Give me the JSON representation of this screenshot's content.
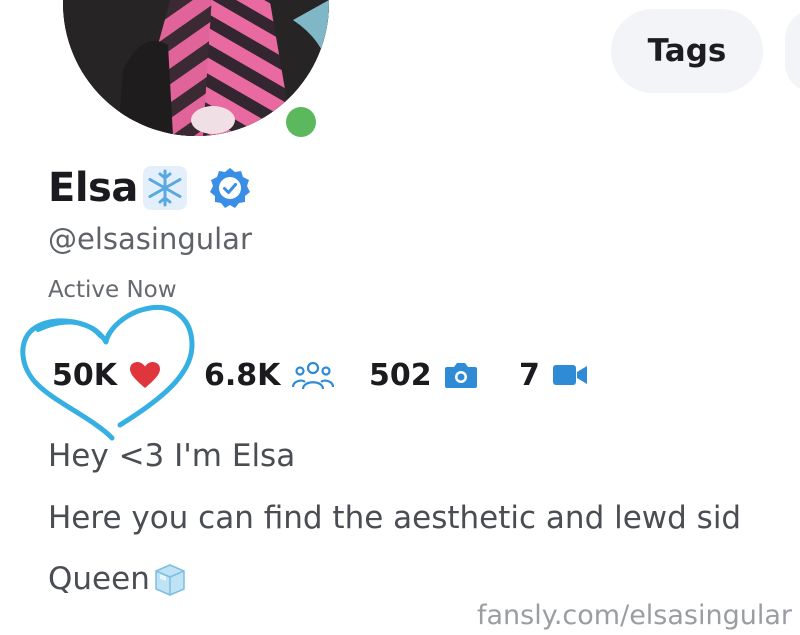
{
  "profile": {
    "name": "Elsa",
    "handle": "@elsasingular",
    "status": "Active Now",
    "online_color": "#5cb85c",
    "verified_color": "#3a8ee6"
  },
  "tabs": {
    "tags_label": "Tags"
  },
  "stats": {
    "likes": "50K",
    "fans": "6.8K",
    "photos": "502",
    "videos": "7",
    "accent_color": "#2f8bd6",
    "heart_color": "#e0353c"
  },
  "bio": {
    "line1": "Hey <3 I'm Elsa",
    "line2": "Here you can find the aesthetic and lewd sid",
    "line3": "Queen"
  },
  "watermark": {
    "text": "fansly.com/elsasingular"
  },
  "icons": {
    "snowflake": "snowflake-emoji-icon",
    "verified": "verified-badge-icon",
    "heart": "heart-icon",
    "fans": "people-icon",
    "photos": "camera-icon",
    "videos": "video-camera-icon",
    "ice": "ice-cube-emoji-icon"
  }
}
